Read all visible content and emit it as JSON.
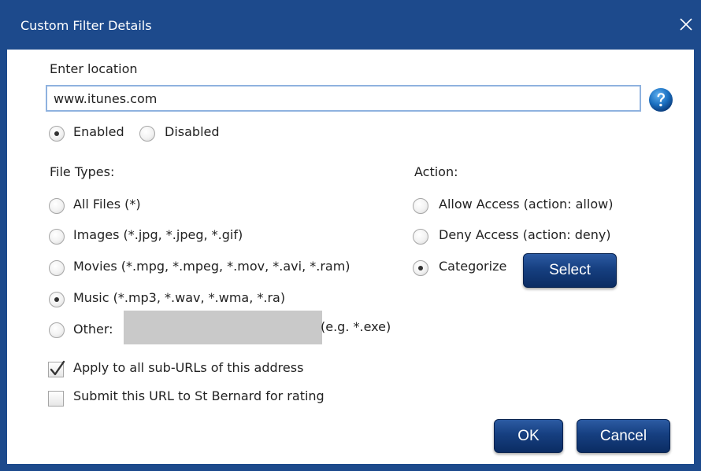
{
  "window": {
    "title": "Custom Filter Details",
    "close_glyph": "close-icon"
  },
  "location": {
    "label": "Enter location",
    "value": "www.itunes.com",
    "help_icon": "help-icon"
  },
  "status": {
    "enabled_label": "Enabled",
    "disabled_label": "Disabled",
    "selected": "Enabled"
  },
  "file_types": {
    "heading": "File Types:",
    "options": [
      {
        "label": "All Files (*)",
        "checked": false
      },
      {
        "label": "Images (*.jpg, *.jpeg, *.gif)",
        "checked": false
      },
      {
        "label": "Movies (*.mpg, *.mpeg, *.mov, *.avi, *.ram)",
        "checked": false
      },
      {
        "label": "Music (*.mp3, *.wav, *.wma, *.ra)",
        "checked": true
      },
      {
        "label": "Other:",
        "checked": false
      }
    ],
    "other_value": "",
    "other_hint": "(e.g. *.exe)"
  },
  "action": {
    "heading": "Action:",
    "options": [
      {
        "label": "Allow Access (action: allow)",
        "checked": false
      },
      {
        "label": "Deny Access (action: deny)",
        "checked": false
      },
      {
        "label": "Categorize",
        "checked": true
      }
    ],
    "select_label": "Select"
  },
  "options": {
    "apply_sub_urls_label": "Apply to all sub-URLs of this address",
    "apply_sub_urls_checked": true,
    "submit_rating_label": "Submit this URL to St Bernard for rating",
    "submit_rating_checked": false
  },
  "footer": {
    "ok_label": "OK",
    "cancel_label": "Cancel"
  },
  "colors": {
    "titlebar": "#1d4a8c",
    "button": "#163f80",
    "input_border": "#8fb2df",
    "help_icon": "#1a6fc0"
  }
}
